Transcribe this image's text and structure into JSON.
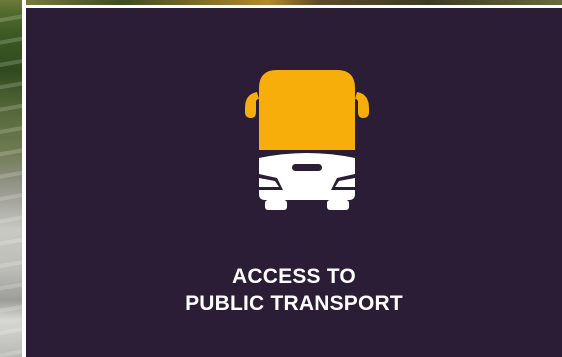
{
  "card": {
    "title_line1": "ACCESS TO",
    "title_line2": "PUBLIC TRANSPORT",
    "icon": "bus-icon",
    "background_color": "#2b1d36",
    "icon_color": "#f7ae0b",
    "text_color": "#ffffff"
  }
}
